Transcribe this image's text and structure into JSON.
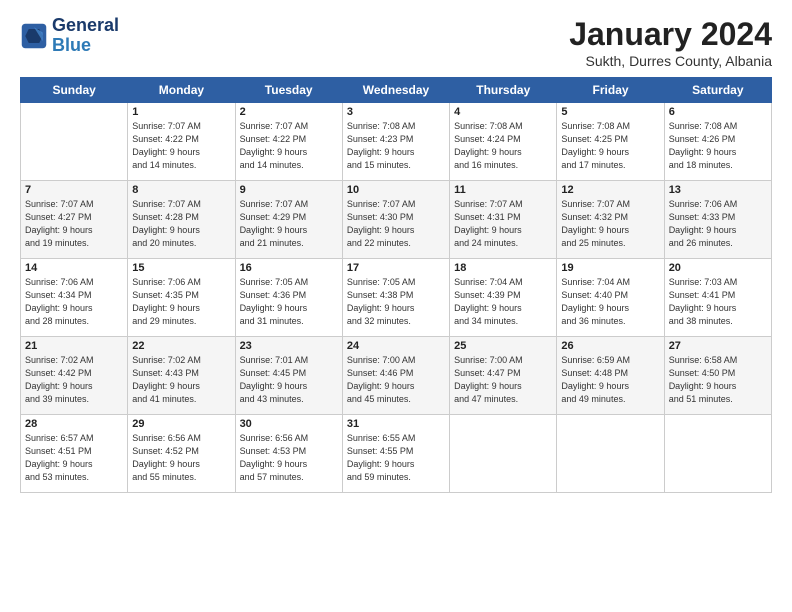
{
  "logo": {
    "line1": "General",
    "line2": "Blue"
  },
  "title": "January 2024",
  "location": "Sukth, Durres County, Albania",
  "days_header": [
    "Sunday",
    "Monday",
    "Tuesday",
    "Wednesday",
    "Thursday",
    "Friday",
    "Saturday"
  ],
  "weeks": [
    [
      {
        "num": "",
        "info": ""
      },
      {
        "num": "1",
        "info": "Sunrise: 7:07 AM\nSunset: 4:22 PM\nDaylight: 9 hours\nand 14 minutes."
      },
      {
        "num": "2",
        "info": "Sunrise: 7:07 AM\nSunset: 4:22 PM\nDaylight: 9 hours\nand 14 minutes."
      },
      {
        "num": "3",
        "info": "Sunrise: 7:08 AM\nSunset: 4:23 PM\nDaylight: 9 hours\nand 15 minutes."
      },
      {
        "num": "4",
        "info": "Sunrise: 7:08 AM\nSunset: 4:24 PM\nDaylight: 9 hours\nand 16 minutes."
      },
      {
        "num": "5",
        "info": "Sunrise: 7:08 AM\nSunset: 4:25 PM\nDaylight: 9 hours\nand 17 minutes."
      },
      {
        "num": "6",
        "info": "Sunrise: 7:08 AM\nSunset: 4:26 PM\nDaylight: 9 hours\nand 18 minutes."
      }
    ],
    [
      {
        "num": "7",
        "info": "Sunrise: 7:07 AM\nSunset: 4:27 PM\nDaylight: 9 hours\nand 19 minutes."
      },
      {
        "num": "8",
        "info": "Sunrise: 7:07 AM\nSunset: 4:28 PM\nDaylight: 9 hours\nand 20 minutes."
      },
      {
        "num": "9",
        "info": "Sunrise: 7:07 AM\nSunset: 4:29 PM\nDaylight: 9 hours\nand 21 minutes."
      },
      {
        "num": "10",
        "info": "Sunrise: 7:07 AM\nSunset: 4:30 PM\nDaylight: 9 hours\nand 22 minutes."
      },
      {
        "num": "11",
        "info": "Sunrise: 7:07 AM\nSunset: 4:31 PM\nDaylight: 9 hours\nand 24 minutes."
      },
      {
        "num": "12",
        "info": "Sunrise: 7:07 AM\nSunset: 4:32 PM\nDaylight: 9 hours\nand 25 minutes."
      },
      {
        "num": "13",
        "info": "Sunrise: 7:06 AM\nSunset: 4:33 PM\nDaylight: 9 hours\nand 26 minutes."
      }
    ],
    [
      {
        "num": "14",
        "info": "Sunrise: 7:06 AM\nSunset: 4:34 PM\nDaylight: 9 hours\nand 28 minutes."
      },
      {
        "num": "15",
        "info": "Sunrise: 7:06 AM\nSunset: 4:35 PM\nDaylight: 9 hours\nand 29 minutes."
      },
      {
        "num": "16",
        "info": "Sunrise: 7:05 AM\nSunset: 4:36 PM\nDaylight: 9 hours\nand 31 minutes."
      },
      {
        "num": "17",
        "info": "Sunrise: 7:05 AM\nSunset: 4:38 PM\nDaylight: 9 hours\nand 32 minutes."
      },
      {
        "num": "18",
        "info": "Sunrise: 7:04 AM\nSunset: 4:39 PM\nDaylight: 9 hours\nand 34 minutes."
      },
      {
        "num": "19",
        "info": "Sunrise: 7:04 AM\nSunset: 4:40 PM\nDaylight: 9 hours\nand 36 minutes."
      },
      {
        "num": "20",
        "info": "Sunrise: 7:03 AM\nSunset: 4:41 PM\nDaylight: 9 hours\nand 38 minutes."
      }
    ],
    [
      {
        "num": "21",
        "info": "Sunrise: 7:02 AM\nSunset: 4:42 PM\nDaylight: 9 hours\nand 39 minutes."
      },
      {
        "num": "22",
        "info": "Sunrise: 7:02 AM\nSunset: 4:43 PM\nDaylight: 9 hours\nand 41 minutes."
      },
      {
        "num": "23",
        "info": "Sunrise: 7:01 AM\nSunset: 4:45 PM\nDaylight: 9 hours\nand 43 minutes."
      },
      {
        "num": "24",
        "info": "Sunrise: 7:00 AM\nSunset: 4:46 PM\nDaylight: 9 hours\nand 45 minutes."
      },
      {
        "num": "25",
        "info": "Sunrise: 7:00 AM\nSunset: 4:47 PM\nDaylight: 9 hours\nand 47 minutes."
      },
      {
        "num": "26",
        "info": "Sunrise: 6:59 AM\nSunset: 4:48 PM\nDaylight: 9 hours\nand 49 minutes."
      },
      {
        "num": "27",
        "info": "Sunrise: 6:58 AM\nSunset: 4:50 PM\nDaylight: 9 hours\nand 51 minutes."
      }
    ],
    [
      {
        "num": "28",
        "info": "Sunrise: 6:57 AM\nSunset: 4:51 PM\nDaylight: 9 hours\nand 53 minutes."
      },
      {
        "num": "29",
        "info": "Sunrise: 6:56 AM\nSunset: 4:52 PM\nDaylight: 9 hours\nand 55 minutes."
      },
      {
        "num": "30",
        "info": "Sunrise: 6:56 AM\nSunset: 4:53 PM\nDaylight: 9 hours\nand 57 minutes."
      },
      {
        "num": "31",
        "info": "Sunrise: 6:55 AM\nSunset: 4:55 PM\nDaylight: 9 hours\nand 59 minutes."
      },
      {
        "num": "",
        "info": ""
      },
      {
        "num": "",
        "info": ""
      },
      {
        "num": "",
        "info": ""
      }
    ]
  ]
}
